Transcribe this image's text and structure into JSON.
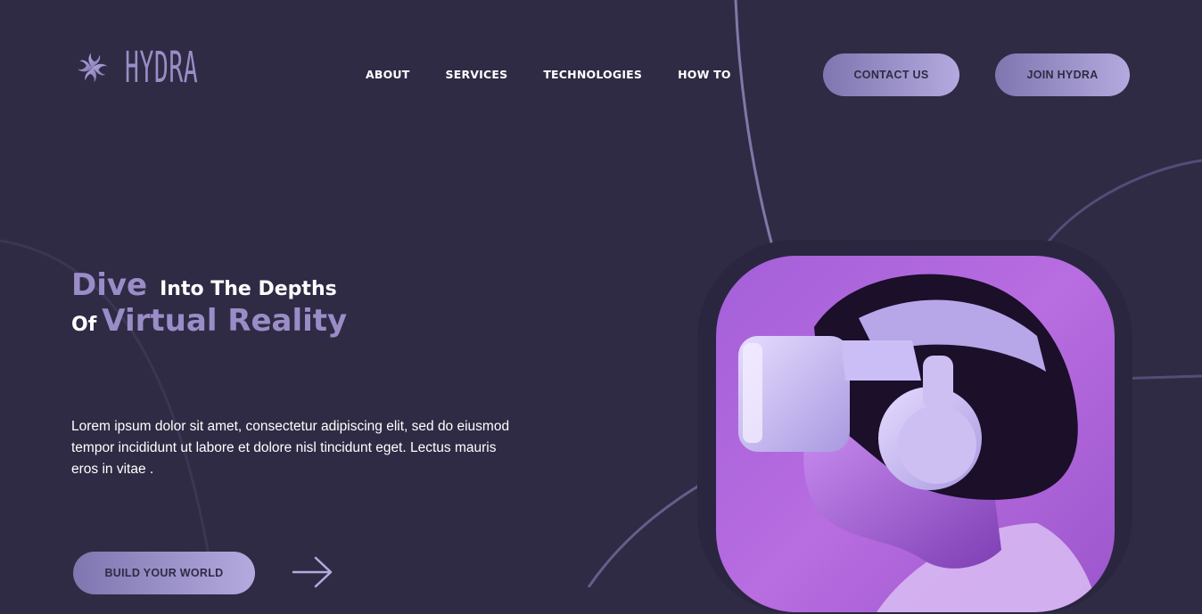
{
  "brand": {
    "name": "HYDRA",
    "logo_icon": "hydra-swirl-logo-icon",
    "accent_color": "#9a8dc7",
    "background_color": "#2f2b44"
  },
  "nav": {
    "items": [
      {
        "label": "ABOUT"
      },
      {
        "label": "SERVICES"
      },
      {
        "label": "TECHNOLOGIES"
      },
      {
        "label": "HOW TO"
      }
    ]
  },
  "header_buttons": {
    "contact_label": "CONTACT US",
    "join_label": "JOIN HYDRA"
  },
  "hero": {
    "title_word_1": "Dive",
    "title_part_2": "Into The Depths",
    "title_part_3": "Of",
    "title_part_4": "Virtual Reality",
    "description": "Lorem ipsum dolor sit amet, consectetur adipiscing elit, sed do eiusmod tempor incididunt ut labore et dolore nisl tincidunt eget. Lectus mauris eros in vitae .",
    "cta_label": "BUILD YOUR WORLD",
    "cta_arrow_icon": "arrow-right-icon",
    "image_subject": "vr-headset-person-photo"
  }
}
